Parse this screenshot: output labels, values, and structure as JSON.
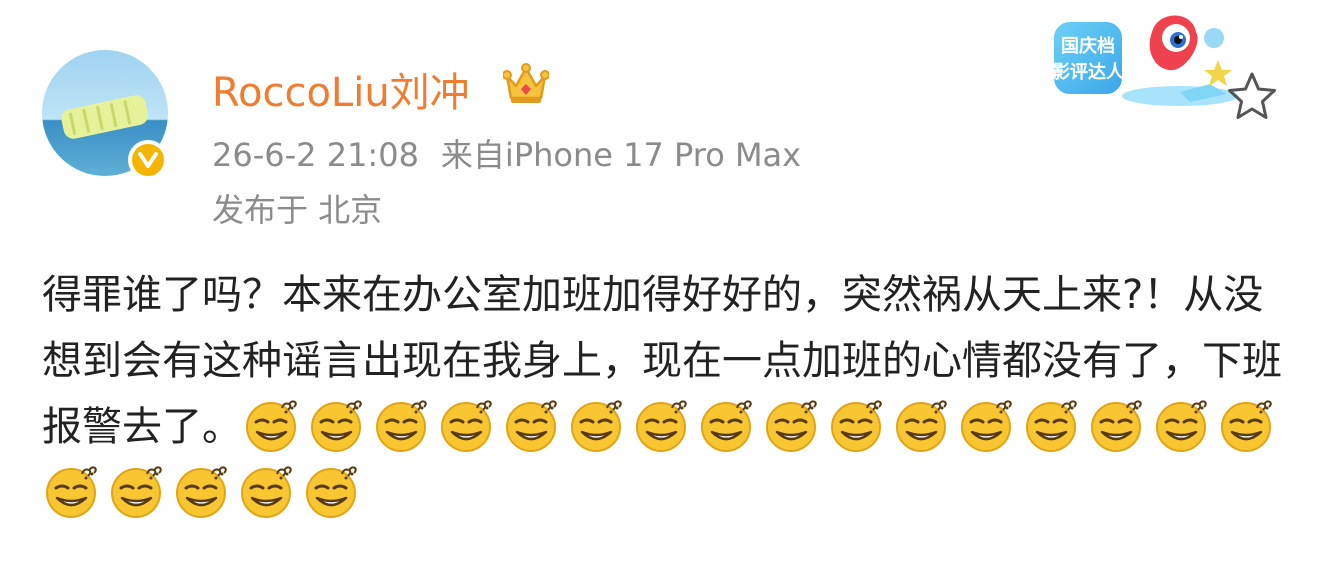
{
  "post": {
    "author": "RoccoLiu刘冲",
    "timestamp": "26-6-2 21:08",
    "source": "来自iPhone 17 Pro Max",
    "location": "发布于 北京",
    "badge_label": "国庆档影评达人",
    "text": "得罪谁了吗？本来在办公室加班加得好好的，突然祸从天上来?！从没想到会有这种谣言出现在我身上，现在一点加班的心情都没有了，下班报警去了。",
    "emoji_name": "doge-sweat-emoji",
    "emoji_count": 21
  },
  "colors": {
    "username": "#ef7c2f",
    "meta": "#8b8b8b",
    "text": "#222222",
    "verified": "#f5b400"
  }
}
